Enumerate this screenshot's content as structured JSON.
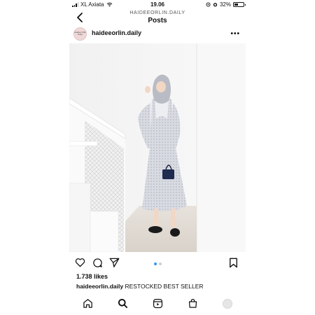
{
  "status_bar": {
    "carrier": "XL Axiata",
    "time": "19.06",
    "battery_percent": "32%"
  },
  "header": {
    "account": "HAIDEEORLIN.DAILY",
    "title": "Posts"
  },
  "post": {
    "username": "haideeorlin.daily",
    "avatar_text": "Haidee Orlin Daily",
    "more_label": "•••",
    "likes": "1.738 likes",
    "caption_user": "haideeorlin.daily",
    "caption_text": "RESTOCKED BEST SELLER",
    "carousel": {
      "total": 2,
      "active": 1
    }
  },
  "colors": {
    "accent": "#3897f0",
    "text": "#111111"
  },
  "icons": {
    "back": "chevron-left-icon",
    "like": "heart-icon",
    "comment": "comment-icon",
    "share": "send-icon",
    "save": "bookmark-icon",
    "home": "home-icon",
    "search": "search-icon",
    "reels": "reels-icon",
    "shop": "shop-icon"
  }
}
